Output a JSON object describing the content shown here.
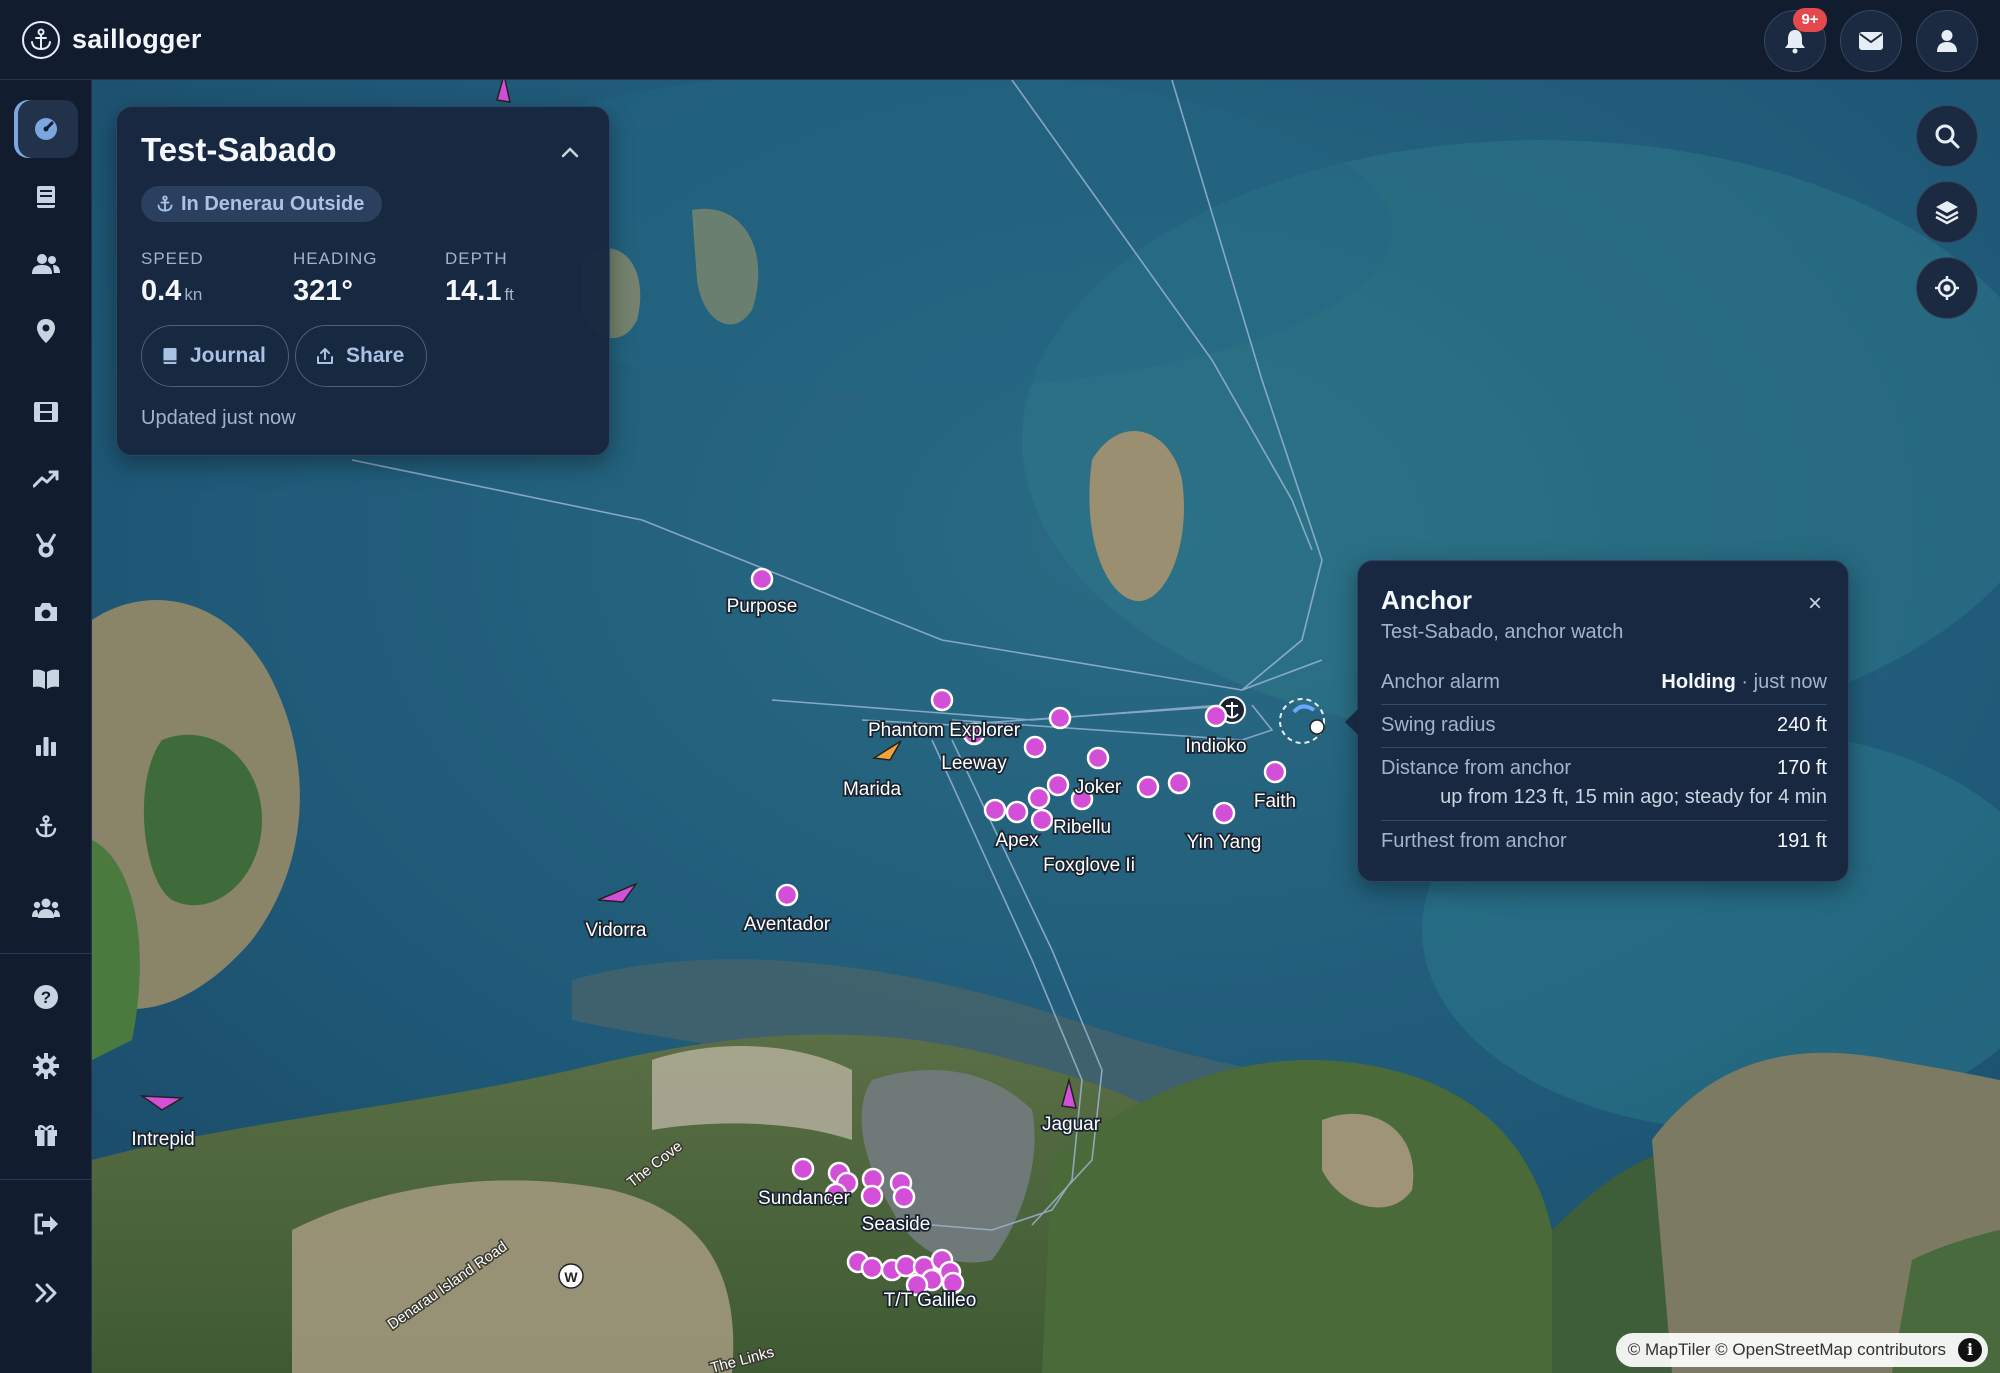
{
  "app": {
    "title": "saillogger",
    "logo_icon": "anchor-icon",
    "notification_badge": "9+"
  },
  "topbar": {
    "buttons": [
      {
        "icon": "bell-icon"
      },
      {
        "icon": "envelope-icon"
      },
      {
        "icon": "user-icon"
      }
    ]
  },
  "sidebar": {
    "items": [
      {
        "icon": "dashboard-icon",
        "active": true
      },
      {
        "icon": "logbook-icon"
      },
      {
        "icon": "crew-icon"
      },
      {
        "icon": "location-pin-icon"
      },
      {
        "icon": "film-icon"
      },
      {
        "icon": "trend-icon"
      },
      {
        "icon": "medal-icon"
      },
      {
        "icon": "camera-icon"
      },
      {
        "icon": "book-icon"
      },
      {
        "icon": "bar-chart-icon"
      },
      {
        "icon": "anchor-icon"
      },
      {
        "icon": "group-icon"
      },
      {
        "icon": "help-icon"
      },
      {
        "icon": "gear-icon"
      },
      {
        "icon": "gift-icon"
      },
      {
        "icon": "sign-out-icon"
      },
      {
        "icon": "expand-icon"
      }
    ]
  },
  "vessel": {
    "name": "Test-Sabado",
    "location": "In Denerau Outside",
    "stats": [
      {
        "label": "SPEED",
        "value": "0.4",
        "unit": "kn"
      },
      {
        "label": "HEADING",
        "value": "321°",
        "unit": ""
      },
      {
        "label": "DEPTH",
        "value": "14.1",
        "unit": "ft"
      }
    ],
    "journal_label": "Journal",
    "share_label": "Share",
    "updated": "Updated just now"
  },
  "anchor_popup": {
    "title": "Anchor",
    "subtitle": "Test-Sabado, anchor watch",
    "alarm_label": "Anchor alarm",
    "alarm_status": "Holding",
    "alarm_time": "· just now",
    "swing_label": "Swing radius",
    "swing_value": "240 ft",
    "distance_label": "Distance from anchor",
    "distance_value": "170 ft",
    "distance_note": "up from 123 ft, 15 min ago; steady for 4 min",
    "furthest_label": "Furthest from anchor",
    "furthest_value": "191 ft"
  },
  "map": {
    "boats": [
      "Purpose",
      "Phantom Explorer",
      "Leeway",
      "Marida",
      "Joker",
      "Indioko",
      "Faith",
      "Apex",
      "Ribellu",
      "Yin Yang",
      "Foxglove Ii",
      "Vidorra",
      "Aventador",
      "Intrepid",
      "Jaguar",
      "Sundancer",
      "Seaside",
      "T/T Galileo"
    ],
    "places": [
      "The Cove",
      "Denarau Island Road",
      "The Links"
    ],
    "colors": {
      "vessel_marker": "#d34fd8",
      "own_vessel": "#f2a23b",
      "track": "#9fb8d6"
    }
  },
  "attribution": "© MapTiler © OpenStreetMap contributors"
}
